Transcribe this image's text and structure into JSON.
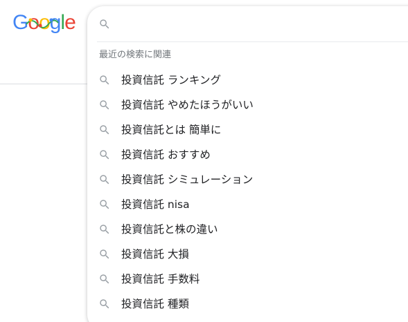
{
  "logo": {
    "letters": [
      {
        "char": "G",
        "color": "#4285f4"
      },
      {
        "char": "o",
        "color": "#ea4335"
      },
      {
        "char": "o",
        "color": "#fbbc05"
      },
      {
        "char": "g",
        "color": "#4285f4"
      },
      {
        "char": "l",
        "color": "#34a853"
      },
      {
        "char": "e",
        "color": "#ea4335"
      }
    ]
  },
  "search": {
    "value": "",
    "placeholder": "",
    "icon": "search-icon"
  },
  "suggestions": {
    "section_title": "最近の検索に関連",
    "icon": "search-icon",
    "items": [
      {
        "text": "投資信託 ランキング"
      },
      {
        "text": "投資信託 やめたほうがいい"
      },
      {
        "text": "投資信託とは 簡単に"
      },
      {
        "text": "投資信託 おすすめ"
      },
      {
        "text": "投資信託 シミュレーション"
      },
      {
        "text": "投資信託 nisa"
      },
      {
        "text": "投資信託と株の違い"
      },
      {
        "text": "投資信託 大損"
      },
      {
        "text": "投資信託 手数料"
      },
      {
        "text": "投資信託 種類"
      }
    ]
  },
  "colors": {
    "icon_gray": "#70757a",
    "text": "#202124",
    "secondary_text": "#70757a"
  }
}
